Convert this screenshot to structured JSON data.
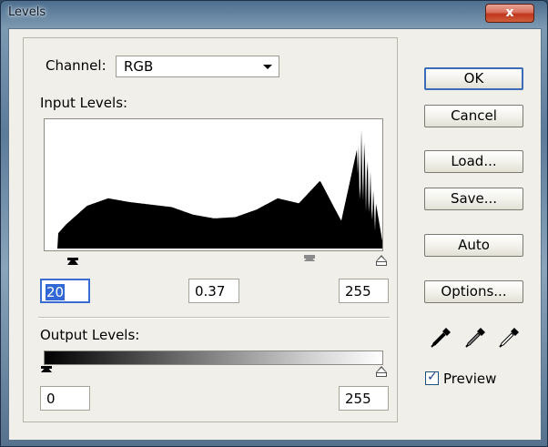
{
  "window": {
    "title": "Levels",
    "close_glyph": "x"
  },
  "channel": {
    "label": "Channel:",
    "value": "RGB"
  },
  "input_levels": {
    "label": "Input Levels:",
    "black_value": "20",
    "gamma_value": "0.37",
    "white_value": "255"
  },
  "output_levels": {
    "label": "Output Levels:",
    "black_value": "0",
    "white_value": "255"
  },
  "buttons": {
    "ok": "OK",
    "cancel": "Cancel",
    "load": "Load...",
    "save": "Save...",
    "auto": "Auto",
    "options": "Options..."
  },
  "preview": {
    "label": "Preview",
    "checked": true
  },
  "icons": {
    "eyedroppers": [
      "black-eyedropper-icon",
      "gray-eyedropper-icon",
      "white-eyedropper-icon"
    ]
  },
  "histogram": {
    "levels": [
      0,
      16,
      32,
      48,
      64,
      80,
      96,
      112,
      128,
      144,
      160,
      176,
      192,
      208,
      224,
      240,
      255
    ],
    "heights": [
      0.0,
      0.19,
      0.34,
      0.4,
      0.37,
      0.35,
      0.33,
      0.27,
      0.24,
      0.25,
      0.31,
      0.4,
      0.36,
      0.54,
      0.22,
      0.99,
      0.06
    ]
  }
}
